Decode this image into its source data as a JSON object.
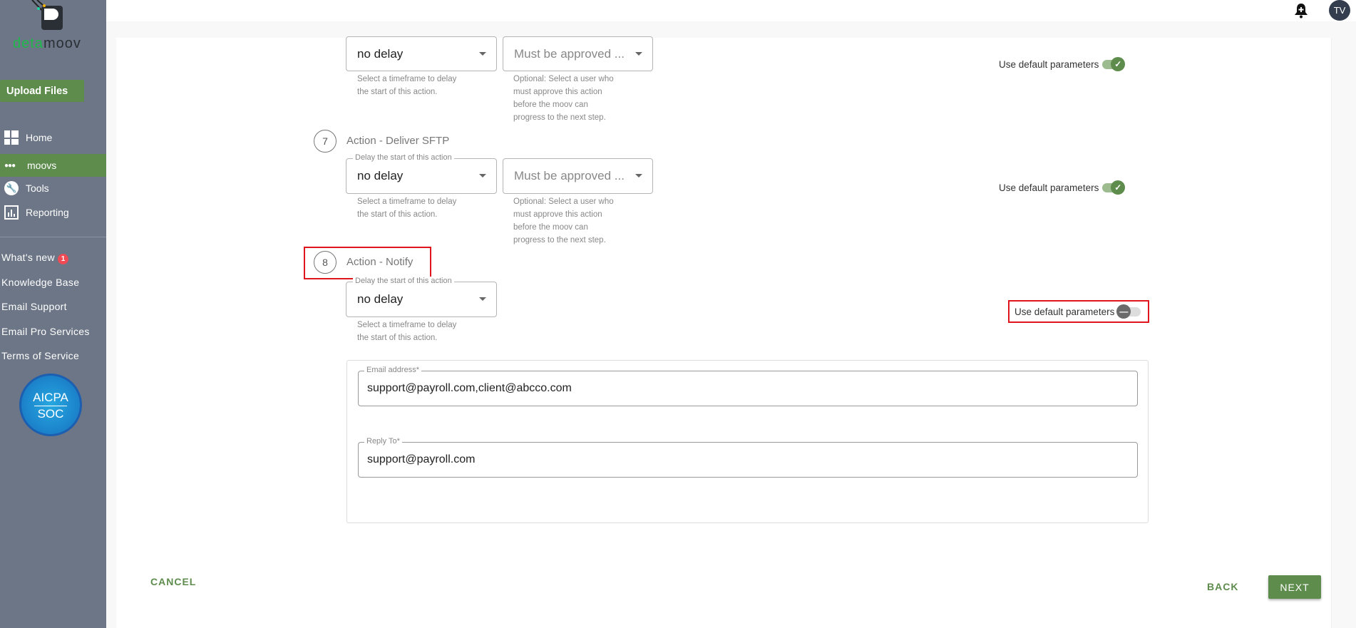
{
  "brand": {
    "logo_text_a": "deta",
    "logo_text_b": "moov"
  },
  "sidebar": {
    "upload_label": "Upload Files",
    "nav": [
      {
        "label": "Home",
        "icon": "dashboard-icon"
      },
      {
        "label": "moovs",
        "icon": "dots-icon",
        "active": true
      },
      {
        "label": "Tools",
        "icon": "wrench-icon"
      },
      {
        "label": "Reporting",
        "icon": "chart-icon"
      }
    ],
    "links": [
      {
        "label": "What's new",
        "badge": "1"
      },
      {
        "label": "Knowledge Base"
      },
      {
        "label": "Email Support"
      },
      {
        "label": "Email Pro Services"
      },
      {
        "label": "Terms of Service"
      }
    ],
    "badge": {
      "line1": "AICPA",
      "line2": "SOC"
    }
  },
  "header": {
    "avatar": "TV"
  },
  "delay_legend": "Delay the start of this action",
  "delay_value": "no delay",
  "delay_help1": "Select a timeframe to delay",
  "delay_help2": "the start of this action.",
  "approver_placeholder": "Must be approved ...",
  "approver_help": [
    "Optional: Select a user who",
    "must approve this action",
    "before the moov can",
    "progress to the next step."
  ],
  "toggle_label": "Use default parameters",
  "steps": [
    {
      "number": "7",
      "title": "Action - Deliver SFTP",
      "use_default": true
    },
    {
      "number": "8",
      "title": "Action - Notify",
      "use_default": false
    }
  ],
  "step6_use_default": true,
  "notify": {
    "email_label": "Email address*",
    "email_value": "support@payroll.com,client@abcco.com",
    "reply_label": "Reply To*",
    "reply_value": "support@payroll.com"
  },
  "footer": {
    "cancel": "CANCEL",
    "back": "BACK",
    "next": "NEXT"
  },
  "colors": {
    "accent": "#5e8c4c",
    "sidebar": "#6c7686",
    "highlight": "#e0161e"
  }
}
